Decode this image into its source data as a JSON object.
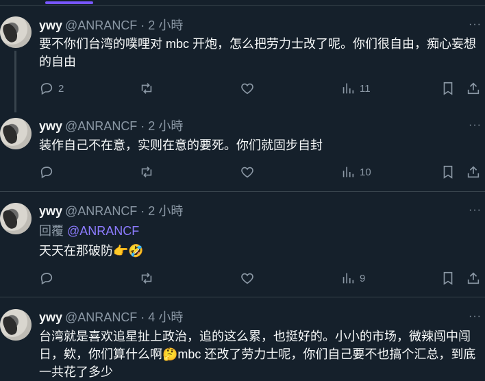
{
  "tweets": [
    {
      "name": "ywy",
      "handle": "@ANRANCF · 2 小時",
      "text": "要不你们台湾的噗哩对 mbc 开炮，怎么把劳力士改了呢。你们很自由，痴心妄想的自由",
      "replies": "2",
      "views": "11",
      "more": "···"
    },
    {
      "name": "ywy",
      "handle": "@ANRANCF · 2 小時",
      "text": "装作自己不在意，实则在意的要死。你们就固步自封",
      "replies": "",
      "views": "10",
      "more": "···"
    },
    {
      "name": "ywy",
      "handle": "@ANRANCF · 2 小時",
      "reply_prefix": "回覆",
      "reply_mention": "@ANRANCF",
      "text": "天天在那破防👉🤣",
      "replies": "",
      "views": "9",
      "more": "···"
    },
    {
      "name": "ywy",
      "handle": "@ANRANCF · 4 小時",
      "text": "台湾就是喜欢追星扯上政治，追的这么累，也挺好的。小小的市场，微辣闯中闯日，欸，你们算什么啊🤔mbc 还改了劳力士呢，你们自己要不也搞个汇总，到底一共花了多少",
      "more": "···"
    }
  ],
  "colors": {
    "background": "#15202b",
    "accent": "#7856ff",
    "muted": "#8b98a5",
    "divider": "#38444d"
  },
  "icons": [
    "reply-icon",
    "retweet-icon",
    "like-icon",
    "views-icon",
    "bookmark-icon",
    "share-icon"
  ]
}
